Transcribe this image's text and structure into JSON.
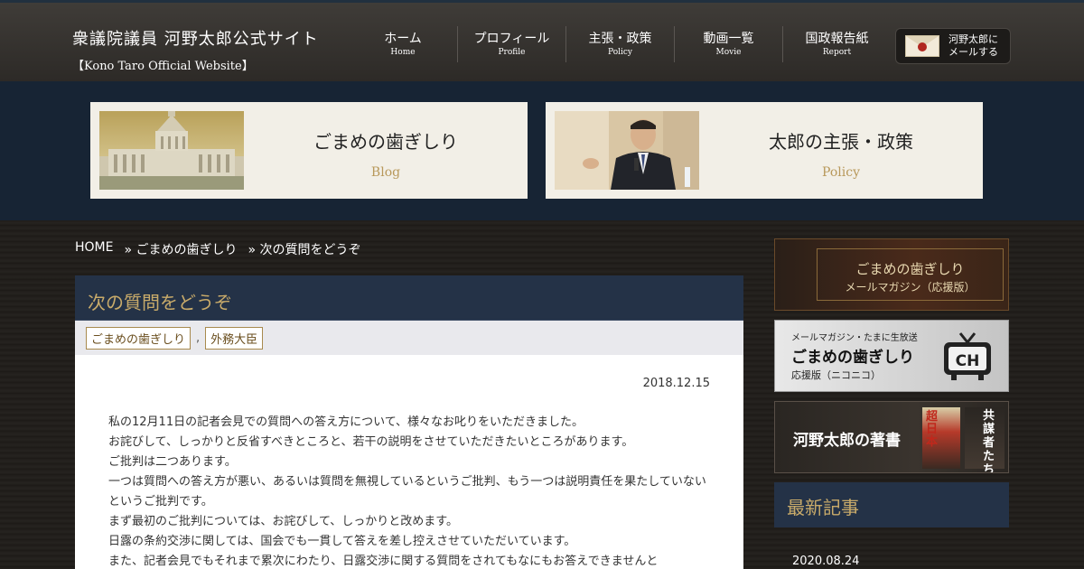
{
  "header": {
    "site_title": "衆議院議員 河野太郎公式サイト",
    "site_subtitle": "【Kono Taro Official Website】",
    "nav": [
      {
        "jp": "ホーム",
        "en": "Home"
      },
      {
        "jp": "プロフィール",
        "en": "Profile"
      },
      {
        "jp": "主張・政策",
        "en": "Policy"
      },
      {
        "jp": "動画一覧",
        "en": "Movie"
      },
      {
        "jp": "国政報告紙",
        "en": "Report"
      }
    ],
    "mail_line1": "河野太郎に",
    "mail_line2": "メールする"
  },
  "features": [
    {
      "title": "ごまめの歯ぎしり",
      "en": "Blog"
    },
    {
      "title": "太郎の主張・政策",
      "en": "Policy"
    }
  ],
  "breadcrumb": [
    "HOME",
    "» ごまめの歯ぎしり",
    "» 次の質問をどうぞ"
  ],
  "article": {
    "title": "次の質問をどうぞ",
    "tags": [
      "ごまめの歯ぎしり",
      "外務大臣"
    ],
    "tag_separator": ",",
    "date": "2018.12.15",
    "paragraphs": [
      "私の12月11日の記者会見での質問への答え方について、様々なお叱りをいただきました。",
      "お詫びして、しっかりと反省すべきところと、若干の説明をさせていただきたいところがあります。",
      "ご批判は二つあります。",
      "一つは質問への答え方が悪い、あるいは質問を無視しているというご批判、もう一つは説明責任を果たしていないというご批判です。",
      "まず最初のご批判については、お詫びして、しっかりと改めます。",
      "日露の条約交渉に関しては、国会でも一貫して答えを差し控えさせていただいています。",
      "また、記者会見でもそれまで累次にわたり、日露交渉に関する質問をされてもなにもお答えできませんと"
    ]
  },
  "sidebar": {
    "banner1": {
      "line1": "ごまめの歯ぎしり",
      "line2": "メールマガジン（応援版）"
    },
    "banner2": {
      "line1": "メールマガジン・たまに生放送",
      "line2": "ごまめの歯ぎしり",
      "line3": "応援版（ニコニコ）",
      "logo": "CH"
    },
    "banner3": {
      "title": "河野太郎の著書",
      "book1": "超日本",
      "book2": "共謀者たち"
    },
    "latest_title": "最新記事",
    "latest_date": "2020.08.24"
  },
  "colors": {
    "accent_gold": "#c9ab6a",
    "navy": "#243247",
    "band": "#172434"
  }
}
